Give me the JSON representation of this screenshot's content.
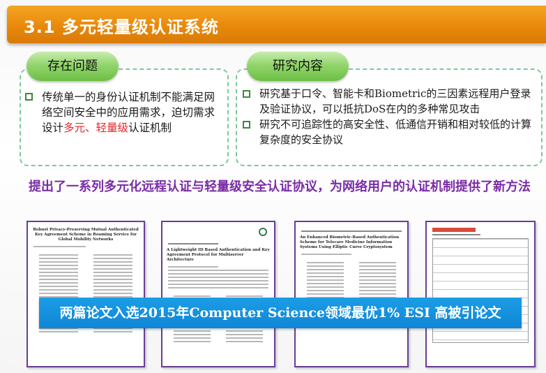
{
  "header": {
    "title": "3.1 多元轻量级认证系统"
  },
  "left_panel": {
    "label": "存在问题",
    "bullets": [
      {
        "segments": [
          {
            "text": "传统单一的身份认证机制不能满足网络空间安全中的应用需求，迫切需求设计",
            "red": false
          },
          {
            "text": "多元、轻量级",
            "red": true
          },
          {
            "text": "认证机制",
            "red": false
          }
        ]
      }
    ]
  },
  "right_panel": {
    "label": "研究内容",
    "bullets": [
      "研究基于口令、智能卡和Biometric的三因素远程用户登录及验证协议，可以抵抗DoS在内的多种常见攻击",
      "研究不可追踪性的高安全性、低通信开销和相对较低的计算复杂度的安全协议"
    ]
  },
  "summary": "提出了一系列多元化远程认证与轻量级安全认证协议，为网络用户的认证机制提供了新方法",
  "papers": [
    {
      "title": "Robust Privacy-Preserving Mutual Authenticated Key Agreement Scheme in Roaming Service for Global Mobility Networks"
    },
    {
      "title": "A Lightweight ID Based Authentication and Key Agreement Protocol for Multiserver Architecture"
    },
    {
      "title": "An Enhanced Biometric-Based Authentication Scheme for Telecare Medicine Information Systems Using Elliptic Curve Cryptosystem"
    },
    {
      "title": ""
    }
  ],
  "banner": "两篇论文入选2015年Computer Science领域最优1% ESI 高被引论文",
  "colors": {
    "title_bar": "#e8890c",
    "pill_green": "#7cc751",
    "panel_border": "#7ec89a",
    "summary_purple": "#7a2ca6",
    "banner_blue": "#1393e0",
    "highlight_red": "#e8262a"
  }
}
